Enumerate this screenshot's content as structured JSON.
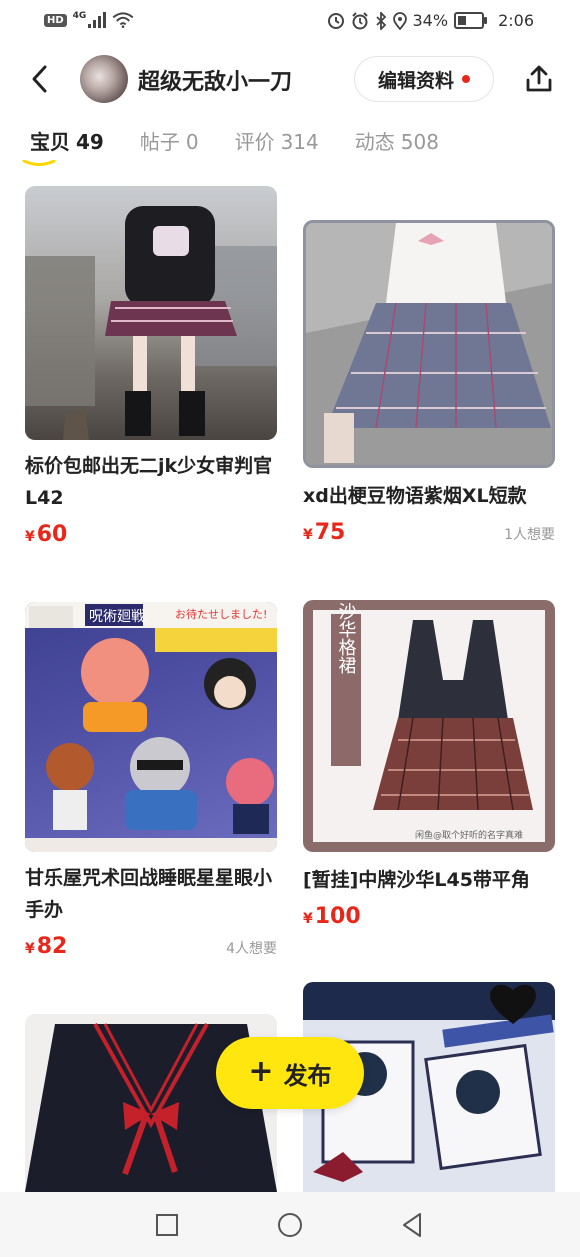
{
  "status_bar": {
    "left_badge": "HD",
    "network": "4G",
    "right_icons": [
      "alarm-icon",
      "bluetooth-icon",
      "location-icon"
    ],
    "battery_percent": "34%",
    "time": "2:06"
  },
  "header": {
    "nickname": "超级无敌小一刀",
    "edit_label": "编辑资料"
  },
  "tabs": [
    {
      "label": "宝贝",
      "count": "49",
      "active": true
    },
    {
      "label": "帖子",
      "count": "0",
      "active": false
    },
    {
      "label": "评价",
      "count": "314",
      "active": false
    },
    {
      "label": "动态",
      "count": "508",
      "active": false
    }
  ],
  "items": [
    {
      "title": "标价包邮出无二jk少女审判官L42",
      "currency": "¥",
      "price": "60",
      "want": ""
    },
    {
      "title": "xd出梗豆物语紫烟XL短款",
      "currency": "¥",
      "price": "75",
      "want": "1人想要"
    },
    {
      "title": "甘乐屋咒术回战睡眠星星眼小手办",
      "currency": "¥",
      "price": "82",
      "want": "4人想要"
    },
    {
      "title": "[暂挂]中牌沙华L45带平角",
      "currency": "¥",
      "price": "100",
      "want": ""
    }
  ],
  "image_text": {
    "figure_brand": "呪術廻戦",
    "figure_banner": "お待たせしました!",
    "skirt_label": "沙华格裙",
    "skirt_watermark": "闲鱼@取个好听的名字真难"
  },
  "fab": {
    "label": "发布"
  },
  "colors": {
    "accent": "#FFE60F",
    "price": "#E8271B"
  }
}
